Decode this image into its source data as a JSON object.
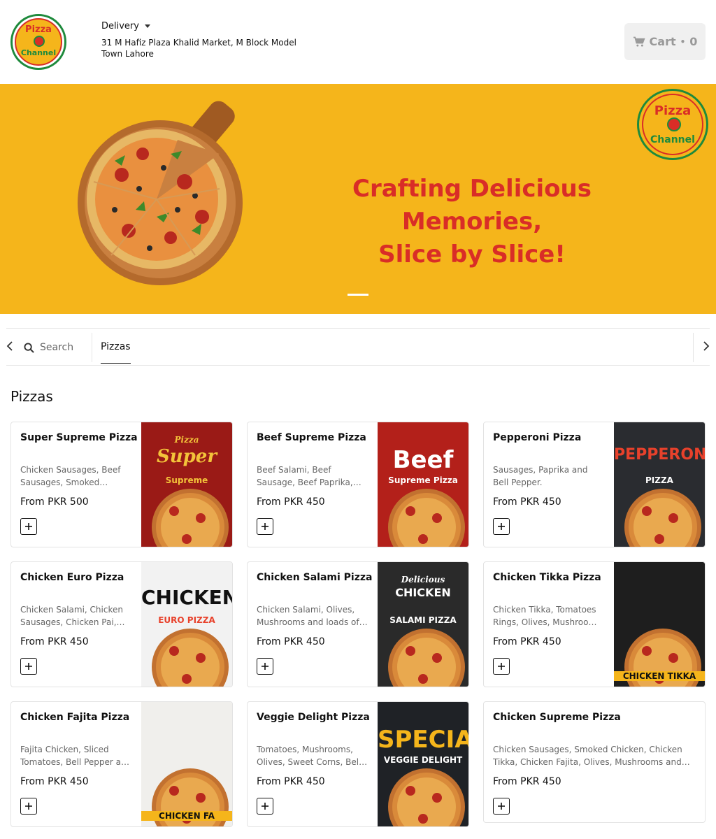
{
  "header": {
    "logo_top": "Pizza",
    "logo_bottom": "Channel",
    "delivery_mode": "Delivery",
    "address": "31 M Hafiz Plaza Khalid Market, M Block Model Town Lahore",
    "cart_label": "Cart",
    "cart_separator": "•",
    "cart_count": "0"
  },
  "banner": {
    "tagline_line1": "Crafting Delicious Memories,",
    "tagline_line2": "Slice by Slice!",
    "logo_top": "Pizza",
    "logo_bottom": "Channel",
    "background_color": "#f5b51b",
    "tagline_color": "#d92d27"
  },
  "category_bar": {
    "search_placeholder": "Search",
    "tabs": [
      {
        "label": "Pizzas",
        "active": true
      }
    ]
  },
  "section": {
    "title": "Pizzas"
  },
  "products": [
    {
      "name": "Super Supreme Pizza",
      "desc": "Chicken Sausages, Beef Sausages, Smoked Chicken, Olives, Mushrooms and Bell Pepper",
      "price": "From PKR 500",
      "img_title": "Super",
      "img_sub": "Supreme",
      "img_small": "Pizza"
    },
    {
      "name": "Beef Supreme Pizza",
      "desc": "Beef Salami, Beef Sausage, Beef Paprika, Olives, Mushrooms and Bell Pepper",
      "price": "From PKR 450",
      "img_title": "Beef",
      "img_sub": "Supreme Pizza",
      "img_small": ""
    },
    {
      "name": "Pepperoni Pizza",
      "desc": "Sausages, Paprika and Bell Pepper.",
      "price": "From PKR 450",
      "img_title": "PEPPERONI",
      "img_sub": "PIZZA",
      "img_small": ""
    },
    {
      "name": "Chicken Euro Pizza",
      "desc": "Chicken Salami, Chicken Sausages, Chicken Pai, Olives and Bell Pepper",
      "price": "From PKR 450",
      "img_title": "CHICKEN",
      "img_sub": "EURO PIZZA",
      "img_small": ""
    },
    {
      "name": "Chicken Salami Pizza",
      "desc": "Chicken Salami, Olives, Mushrooms and loads of Cheese",
      "price": "From PKR 450",
      "img_title": "CHICKEN",
      "img_sub": "SALAMI PIZZA",
      "img_small": "Delicious"
    },
    {
      "name": "Chicken Tikka Pizza",
      "desc": "Chicken Tikka, Tomatoes Rings, Olives, Mushroom, Onion and Bell Pepper",
      "price": "From PKR 450",
      "img_title": "",
      "img_sub": "CHICKEN TIKKA",
      "img_small": ""
    },
    {
      "name": "Chicken Fajita Pizza",
      "desc": "Fajita Chicken, Sliced Tomatoes, Bell Pepper and Onion",
      "price": "From PKR 450",
      "img_title": "",
      "img_sub": "CHICKEN FA",
      "img_small": ""
    },
    {
      "name": "Veggie Delight Pizza",
      "desc": "Tomatoes, Mushrooms, Olives, Sweet Corns, Bell Pepper and Onion",
      "price": "From PKR 450",
      "img_title": "SPECIAL",
      "img_sub": "VEGGIE DELIGHT",
      "img_small": ""
    },
    {
      "name": "Chicken Supreme Pizza",
      "desc": "Chicken Sausages, Smoked Chicken, Chicken Tikka, Chicken Fajita, Olives, Mushrooms and Bell Pepper",
      "price": "From PKR 450",
      "img_title": "",
      "img_sub": "",
      "img_small": ""
    }
  ]
}
